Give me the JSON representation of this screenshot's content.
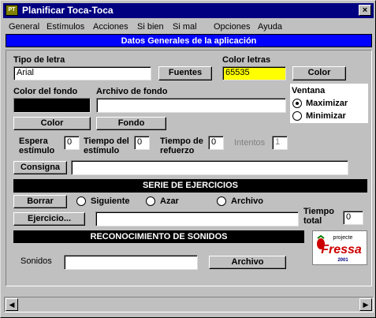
{
  "window": {
    "title": "Planificar Toca-Toca",
    "close_glyph": "×",
    "app_icon_text": "PT"
  },
  "menu": [
    "General",
    "Estímulos",
    "Acciones",
    "Si bien",
    "Si mal",
    "Opciones",
    "Ayuda"
  ],
  "header": "Datos Generales de la aplicación",
  "font": {
    "label": "Tipo de letra",
    "value": "Arial",
    "button": "Fuentes"
  },
  "font_color": {
    "label": "Color letras",
    "value": "65535",
    "button": "Color",
    "swatch": "#ffff00"
  },
  "bg_color": {
    "label": "Color del fondo",
    "button": "Color",
    "swatch": "#000000"
  },
  "bg_file": {
    "label": "Archivo de fondo",
    "value": "",
    "button": "Fondo"
  },
  "ventana": {
    "label": "Ventana",
    "options": [
      "Maximizar",
      "Minimizar"
    ],
    "selected": "Maximizar"
  },
  "timing": {
    "espera_label_1": "Espera",
    "espera_label_2": "estímulo",
    "espera_value": "0",
    "tiempo_estimulo_label_1": "Tiempo del",
    "tiempo_estimulo_label_2": "estímulo",
    "tiempo_estimulo_value": "0",
    "tiempo_refuerzo_label_1": "Tiempo de",
    "tiempo_refuerzo_label_2": "refuerzo",
    "tiempo_refuerzo_value": "0",
    "intentos_label": "Intentos",
    "intentos_value": "1"
  },
  "consigna": {
    "button": "Consigna",
    "value": ""
  },
  "serie": {
    "title": "SERIE DE EJERCICIOS",
    "clear_button": "Borrar",
    "options": [
      "Siguiente",
      "Azar",
      "Archivo"
    ],
    "exercise_button": "Ejercicio...",
    "exercise_value": "",
    "total_label_1": "Tiempo",
    "total_label_2": "total",
    "total_value": "0"
  },
  "sonidos": {
    "title": "RECONOCIMIENTO DE SONIDOS",
    "label": "Sonidos",
    "value": "",
    "button": "Archivo"
  },
  "logo": {
    "top_text": "projecte",
    "main_text": "Fressa",
    "year": "2001"
  },
  "scrollbar": {
    "left_glyph": "◀",
    "right_glyph": "▶"
  }
}
